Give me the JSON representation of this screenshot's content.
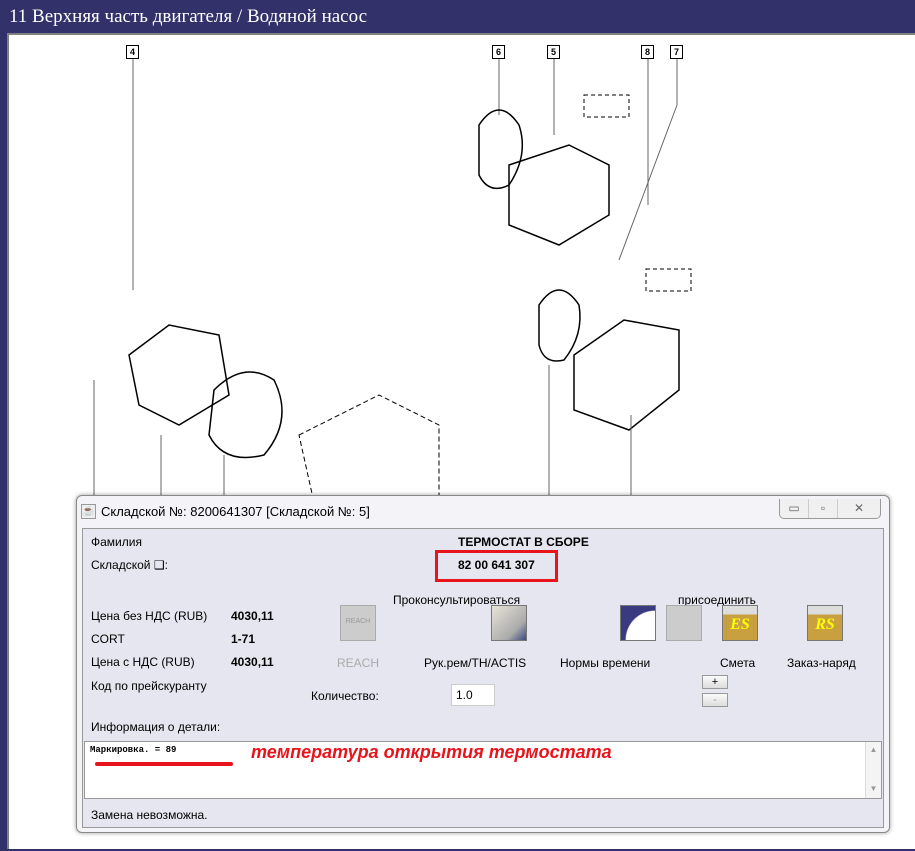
{
  "window": {
    "title": "11 Верхняя часть двигателя / Водяной насос"
  },
  "diagram": {
    "callouts": [
      "4",
      "6",
      "5",
      "8",
      "7"
    ]
  },
  "dialog": {
    "title": "Складской №: 8200641307 [Складской №: 5]",
    "controls": {
      "minimize": "▭",
      "maximize": "▫",
      "close": "✕"
    },
    "family_label": "Фамилия",
    "part_name": "ТЕРМОСТАТ В СБОРЕ",
    "stock_label": "Складской ❑:",
    "stock_number": "82 00 641 307",
    "price_no_vat_label": "Цена без НДС (RUB)",
    "price_no_vat": "4030,11",
    "cort_label": "CORT",
    "cort": "1-71",
    "price_vat_label": "Цена с НДС (RUB)",
    "price_vat": "4030,11",
    "pricelist_code_label": "Код по прейскуранту",
    "consult_label": "Проконсультироваться",
    "attach_label": "присоединить",
    "buttons": {
      "reach": "REACH",
      "reach_icon_text": "REACH",
      "manual": "Рук.рем/TH/ACTIS",
      "time_norms": "Нормы времени",
      "estimate": "Смета",
      "work_order": "Заказ-наряд",
      "plus": "+",
      "minus": "-"
    },
    "quantity_label": "Количество:",
    "quantity": "1.0",
    "info_label": "Информация о детали:",
    "info_text": "Маркировка. = 89",
    "annotation": "температура открытия термостата",
    "status": "Замена невозможна.",
    "colors": {
      "highlight": "#e8141c",
      "titlebar": "#32316a"
    }
  }
}
